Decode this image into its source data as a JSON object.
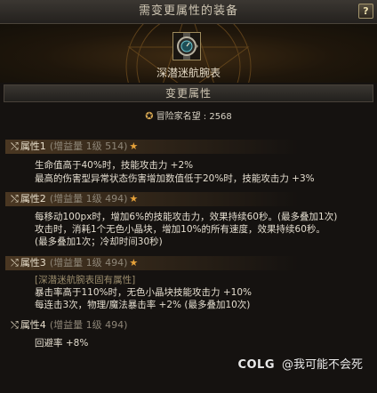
{
  "window": {
    "title": "需变更属性的装备",
    "help_label": "?"
  },
  "item": {
    "name": "深潜迷航腕表",
    "icon": "compass-watch-icon"
  },
  "section": {
    "title": "变更属性"
  },
  "reputation": {
    "label": "冒险家名望 : 2568",
    "icon": "medal-icon"
  },
  "attributes": [
    {
      "name": "属性1",
      "meta": "(增益量 1级 514)",
      "starred": true,
      "lines": [
        "生命值高于40%时，技能攻击力 +2%",
        "最高的伤害型异常状态伤害增加数值低于20%时，技能攻击力 +3%"
      ]
    },
    {
      "name": "属性2",
      "meta": "(增益量 1级 494)",
      "starred": true,
      "lines": [
        "每移动100px时，增加6%的技能攻击力，效果持续60秒。(最多叠加1次)",
        "攻击时，消耗1个无色小晶块，增加10%的所有速度，效果持续60秒。",
        "(最多叠加1次；冷却时间30秒)"
      ]
    },
    {
      "name": "属性3",
      "meta": "(增益量 1级 494)",
      "starred": true,
      "note": "[深潜迷航腕表固有属性]",
      "lines": [
        "暴击率高于110%时，无色小晶块技能攻击力 +10%",
        "每连击3次，物理/魔法暴击率 +2% (最多叠加10次)"
      ]
    },
    {
      "name": "属性4",
      "meta": "(增益量 1级 494)",
      "starred": false,
      "lines": [
        "回避率 +8%"
      ]
    }
  ],
  "watermark": {
    "logo": "COLG",
    "text": "@我可能不会死"
  },
  "colors": {
    "background": "#151210",
    "accent_gold": "#e7a23a",
    "text": "#e4ddcf",
    "muted": "#8e8678"
  }
}
